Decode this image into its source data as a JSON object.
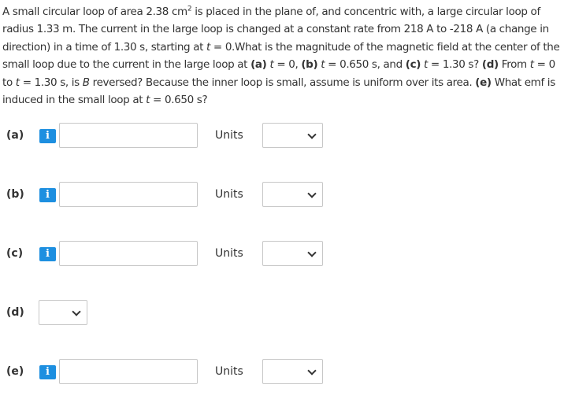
{
  "question": {
    "s1": "A small circular loop of area 2.38 cm",
    "sup": "2",
    "s2": " is placed in the plane of, and concentric with, a large circular loop of radius 1.33 m. The current in the large loop is changed at a constant rate from 218 A to -218 A (a change in direction) in a time of 1.30 s, starting at ",
    "t": "t",
    "s3": " = 0.What is the magnitude of the magnetic field at the center of the small loop due to the current in the large loop at ",
    "a": "(a)",
    "s4": " = 0, ",
    "b": "(b)",
    "s5": " = 0.650 s, and ",
    "c": "(c)",
    "s6": " = 1.30 s? ",
    "d": "(d)",
    "s7": " From ",
    "s8": " = 0 to ",
    "s9": " = 1.30 s, is ",
    "B": "B",
    "s10": " reversed? Because the inner loop is small, assume is uniform over its area. ",
    "e": "(e)",
    "s11": " What emf is induced in the small loop at ",
    "s12": " = 0.650 s?"
  },
  "parts": [
    {
      "label": "(a)",
      "info_icon": "info-icon",
      "value": "",
      "units_label": "Units",
      "units_value": ""
    },
    {
      "label": "(b)",
      "info_icon": "info-icon",
      "value": "",
      "units_label": "Units",
      "units_value": ""
    },
    {
      "label": "(c)",
      "info_icon": "info-icon",
      "value": "",
      "units_label": "Units",
      "units_value": ""
    },
    {
      "label": "(d)",
      "select_value": ""
    },
    {
      "label": "(e)",
      "info_icon": "info-icon",
      "value": "",
      "units_label": "Units",
      "units_value": ""
    }
  ],
  "icons": {
    "info": "info-icon",
    "dropdown": "chevron-down-icon"
  },
  "colors": {
    "info_icon_bg": "#1d8fe0",
    "text": "#333333",
    "border": "#c7c7c7"
  }
}
